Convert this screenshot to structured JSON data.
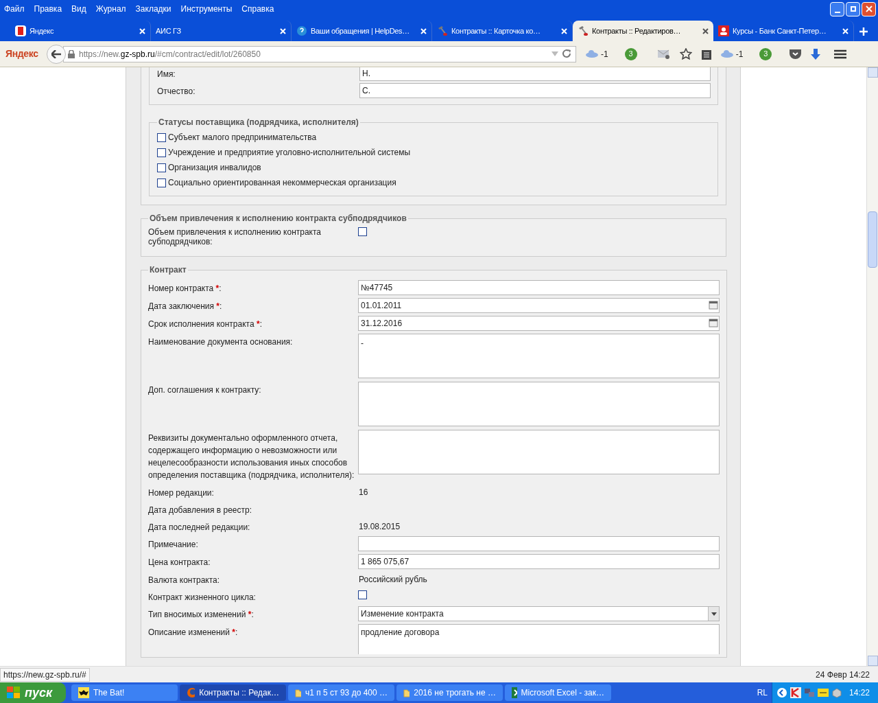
{
  "menu": [
    "Файл",
    "Правка",
    "Вид",
    "Журнал",
    "Закладки",
    "Инструменты",
    "Справка"
  ],
  "tabs": [
    {
      "label": "Яндекс",
      "selected": false
    },
    {
      "label": "АИС ГЗ",
      "selected": false
    },
    {
      "label": "Ваши обращения | HelpDes…",
      "selected": false
    },
    {
      "label": "Контракты :: Карточка ко…",
      "selected": false
    },
    {
      "label": "Контракты :: Редактиров…",
      "selected": true
    },
    {
      "label": "Курсы - Банк Санкт-Петер…",
      "selected": false
    }
  ],
  "navbar": {
    "brand": "Яндекс",
    "url_host": "https://new.",
    "url_domain": "gz-spb.ru",
    "url_path": "/#cm/contract/edit/lot/260850",
    "cloud_count_1": "-1",
    "badge_1": "3",
    "cloud_count_2": "-1",
    "badge_2": "3"
  },
  "person_fields": [
    {
      "label": "Имя:",
      "value": "Н."
    },
    {
      "label": "Отчество:",
      "value": "С."
    }
  ],
  "statuses": {
    "legend": "Статусы поставщика (подрядчика, исполнителя)",
    "items": [
      {
        "label": "Субъект малого предпринимательства",
        "checked": false
      },
      {
        "label": "Учреждение и предприятие уголовно-исполнительной системы",
        "checked": false
      },
      {
        "label": "Организация инвалидов",
        "checked": false
      },
      {
        "label": "Социально ориентированная некоммерческая организация",
        "checked": false
      }
    ]
  },
  "subcontract": {
    "legend": "Объем привлечения к исполнению контракта субподрядчиков",
    "label": "Объем привлечения к исполнению контракта субподрядчиков:",
    "checked": false
  },
  "contract": {
    "legend": "Контракт",
    "rows": [
      {
        "kind": "input",
        "label": "Номер контракта ",
        "required_mark": "*",
        "label_tail": ":",
        "value": "№47745"
      },
      {
        "kind": "date",
        "label": "Дата заключения ",
        "required_mark": "*",
        "label_tail": ":",
        "value": "01.01.2011"
      },
      {
        "kind": "date",
        "label": "Срок исполнения контракта ",
        "required_mark": "*",
        "label_tail": ":",
        "value": "31.12.2016"
      },
      {
        "kind": "textarea",
        "label": "Наименование документа основания:",
        "value": "-"
      },
      {
        "kind": "textarea",
        "label": "Доп. соглашения к контракту:"
      },
      {
        "kind": "textarea",
        "label": "Реквизиты документально оформленного отчета, содержащего информацию о невозможности или нецелесообразности использования иных способов определения поставщика (подрядчика, исполнителя):"
      },
      {
        "kind": "text",
        "label": "Номер редакции:",
        "value": "16"
      },
      {
        "kind": "text",
        "label": "Дата добавления в реестр:"
      },
      {
        "kind": "text",
        "label": "Дата последней редакции:",
        "value": "19.08.2015"
      },
      {
        "kind": "input",
        "label": "Примечание:"
      },
      {
        "kind": "input",
        "label": "Цена контракта:",
        "value": "1 865 075,67"
      },
      {
        "kind": "text",
        "label": "Валюта контракта:",
        "value": "Российский рубль"
      },
      {
        "kind": "checkbox",
        "label": "Контракт жизненного цикла:",
        "checked": false
      },
      {
        "kind": "select",
        "label": "Тип вносимых изменений ",
        "required_mark": "*",
        "label_tail": ":",
        "value": "Изменение контракта"
      },
      {
        "kind": "textarea_cut",
        "label": "Описание изменений ",
        "required_mark": "*",
        "label_tail": ":",
        "value": "продление договора"
      }
    ]
  },
  "status_bar": {
    "link": "https://new.gz-spb.ru/#",
    "datetime": "24 Февр 14:22"
  },
  "taskbar": {
    "start": "пуск",
    "items": [
      {
        "label": "The Bat!",
        "selected": false
      },
      {
        "label": "Контракты :: Редак…",
        "selected": true
      },
      {
        "label": "ч1 п 5 ст 93 до 400 …",
        "selected": false
      },
      {
        "label": "2016 не трогать не …",
        "selected": false
      },
      {
        "label": "Microsoft Excel - зак…",
        "selected": false
      }
    ],
    "lang": "RL",
    "clock": "14:22"
  }
}
